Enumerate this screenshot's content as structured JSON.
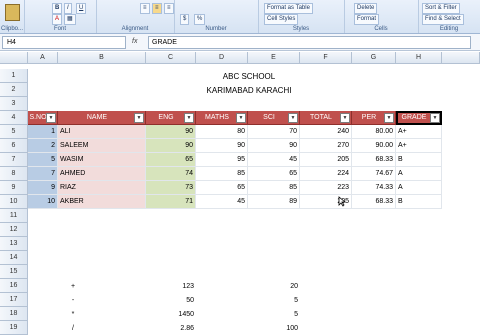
{
  "ribbon": {
    "groups": [
      {
        "name": "clipboard",
        "label": "Clipbo..."
      },
      {
        "name": "font",
        "label": "Font"
      },
      {
        "name": "alignment",
        "label": "Alignment"
      },
      {
        "name": "number",
        "label": "Number"
      },
      {
        "name": "styles",
        "label": "Styles"
      },
      {
        "name": "cells",
        "label": "Cells"
      },
      {
        "name": "editing",
        "label": "Editing"
      }
    ],
    "format_as_table": "Format as Table",
    "cell_styles": "Cell Styles",
    "delete": "Delete",
    "format": "Format",
    "sort_filter": "Sort & Filter",
    "find_select": "Find & Select"
  },
  "formula_bar": {
    "name_box": "H4",
    "fx": "fx",
    "value": "GRADE"
  },
  "columns": [
    "A",
    "B",
    "C",
    "D",
    "E",
    "F",
    "G",
    "H"
  ],
  "rows": [
    "1",
    "2",
    "3",
    "4",
    "5",
    "6",
    "7",
    "8",
    "9",
    "10",
    "11",
    "12",
    "13",
    "14",
    "15",
    "16",
    "17",
    "18",
    "19"
  ],
  "sheet": {
    "title": "ABC SCHOOL",
    "subtitle": "KARIMABAD KARACHI",
    "headers": [
      "S.NO",
      "NAME",
      "ENG",
      "MATHS",
      "SCI",
      "TOTAL",
      "PER",
      "GRADE"
    ],
    "records": [
      [
        "1",
        "ALI",
        "90",
        "80",
        "70",
        "240",
        "80.00",
        "A+"
      ],
      [
        "2",
        "SALEEM",
        "90",
        "90",
        "90",
        "270",
        "90.00",
        "A+"
      ],
      [
        "5",
        "WASIM",
        "65",
        "95",
        "45",
        "205",
        "68.33",
        "B"
      ],
      [
        "7",
        "AHMED",
        "74",
        "85",
        "65",
        "224",
        "74.67",
        "A"
      ],
      [
        "9",
        "RIAZ",
        "73",
        "65",
        "85",
        "223",
        "74.33",
        "A"
      ],
      [
        "10",
        "AKBER",
        "71",
        "45",
        "89",
        "205",
        "68.33",
        "B"
      ]
    ],
    "calc_rows": [
      {
        "row": "16",
        "op": "+",
        "c": "123",
        "e": "20"
      },
      {
        "row": "17",
        "op": "-",
        "c": "50",
        "e": "5"
      },
      {
        "row": "18",
        "op": "*",
        "c": "1450",
        "e": "5"
      },
      {
        "row": "19",
        "op": "/",
        "c": "2.86",
        "e": "100"
      }
    ]
  }
}
